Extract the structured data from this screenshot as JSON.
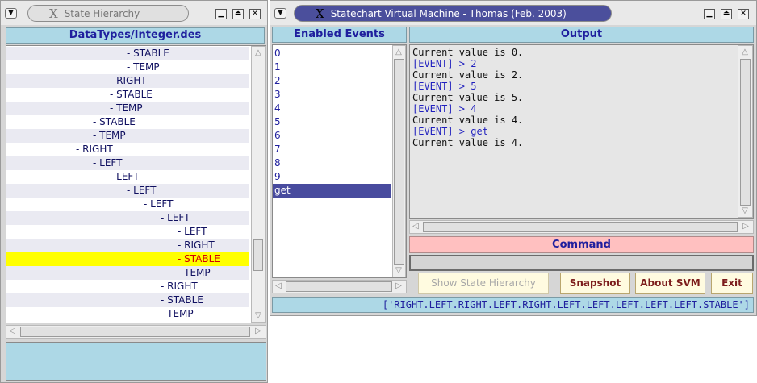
{
  "left_window": {
    "title": "State Hierarchy",
    "header": "DataTypes/Integer.des",
    "tree": [
      {
        "label": "- STABLE",
        "indent": 5,
        "alt": true
      },
      {
        "label": "- TEMP",
        "indent": 5,
        "alt": false
      },
      {
        "label": "- RIGHT",
        "indent": 4,
        "alt": true
      },
      {
        "label": "- STABLE",
        "indent": 4,
        "alt": false
      },
      {
        "label": "- TEMP",
        "indent": 4,
        "alt": true
      },
      {
        "label": "- STABLE",
        "indent": 3,
        "alt": false
      },
      {
        "label": "- TEMP",
        "indent": 3,
        "alt": true
      },
      {
        "label": "- RIGHT",
        "indent": 2,
        "alt": false
      },
      {
        "label": "- LEFT",
        "indent": 3,
        "alt": true
      },
      {
        "label": "- LEFT",
        "indent": 4,
        "alt": false
      },
      {
        "label": "- LEFT",
        "indent": 5,
        "alt": true
      },
      {
        "label": "- LEFT",
        "indent": 6,
        "alt": false
      },
      {
        "label": "- LEFT",
        "indent": 7,
        "alt": true
      },
      {
        "label": "- LEFT",
        "indent": 8,
        "alt": false
      },
      {
        "label": "- RIGHT",
        "indent": 8,
        "alt": true
      },
      {
        "label": "- STABLE",
        "indent": 8,
        "alt": false,
        "selected": true
      },
      {
        "label": "- TEMP",
        "indent": 8,
        "alt": true
      },
      {
        "label": "- RIGHT",
        "indent": 7,
        "alt": false
      },
      {
        "label": "- STABLE",
        "indent": 7,
        "alt": true
      },
      {
        "label": "- TEMP",
        "indent": 7,
        "alt": false
      }
    ]
  },
  "main_window": {
    "title": "Statechart Virtual Machine - Thomas (Feb. 2003)",
    "events_header": "Enabled Events",
    "events": [
      "0",
      "1",
      "2",
      "3",
      "4",
      "5",
      "6",
      "7",
      "8",
      "9",
      "get"
    ],
    "selected_event": "get",
    "output_header": "Output",
    "output_lines": [
      {
        "text": "Current value is 0.",
        "type": "value"
      },
      {
        "text": "[EVENT] > 2",
        "type": "event"
      },
      {
        "text": "Current value is 2.",
        "type": "value"
      },
      {
        "text": "[EVENT] > 5",
        "type": "event"
      },
      {
        "text": "Current value is 5.",
        "type": "value"
      },
      {
        "text": "[EVENT] > 4",
        "type": "event"
      },
      {
        "text": "Current value is 4.",
        "type": "value"
      },
      {
        "text": "[EVENT] > get",
        "type": "event"
      },
      {
        "text": "Current value is 4.",
        "type": "value"
      }
    ],
    "command_header": "Command",
    "command_value": "",
    "buttons": {
      "show_hierarchy": "Show State Hierarchy",
      "snapshot": "Snapshot",
      "about": "About SVM",
      "exit": "Exit"
    },
    "status": "['RIGHT.LEFT.RIGHT.LEFT.RIGHT.LEFT.LEFT.LEFT.LEFT.LEFT.STABLE']"
  },
  "colors": {
    "header_bg": "#add8e6",
    "header_text": "#1f1f9e",
    "command_header_bg": "#ffc0c0",
    "selection_yellow": "#ffff00",
    "selection_text": "#d20000",
    "event_selection": "#484b9e"
  },
  "icons": [
    "menu-arrow-icon",
    "x-logo-icon",
    "minimize-icon",
    "maximize-icon",
    "close-icon",
    "scroll-up-icon",
    "scroll-down-icon",
    "scroll-left-icon",
    "scroll-right-icon"
  ]
}
